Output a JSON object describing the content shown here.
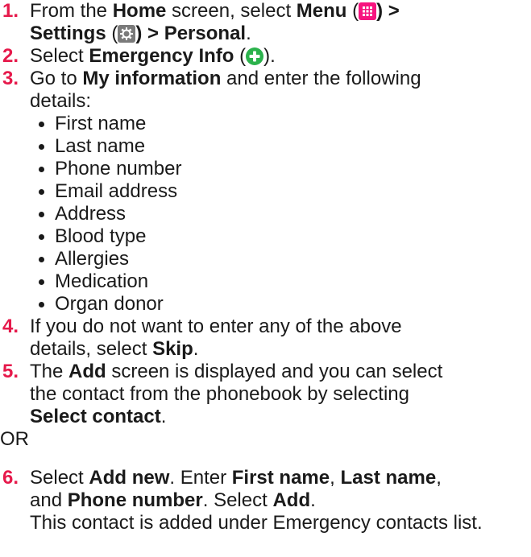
{
  "steps": [
    {
      "number": "1.",
      "line1_pre": "From the ",
      "line1_home": "Home",
      "line1_mid": " screen, select ",
      "line1_menu": "Menu",
      "line1_paren_open": " (",
      "line1_paren_close": ") >",
      "line2_settings": "Settings",
      "line2_paren_open": " (",
      "line2_paren_close": ") > ",
      "line2_personal": "Personal",
      "line2_end": "."
    },
    {
      "number": "2.",
      "pre": "Select ",
      "bold": "Emergency Info",
      "paren_open": " (",
      "paren_close": ")."
    },
    {
      "number": "3.",
      "pre": "Go to ",
      "bold": "My information",
      "post": " and enter the following",
      "line2": "details:",
      "bullets": [
        "First name",
        "Last name",
        "Phone number",
        "Email address",
        "Address",
        "Blood type",
        "Allergies",
        "Medication",
        "Organ donor"
      ]
    },
    {
      "number": "4.",
      "line1": "If you do not want to enter any of the above",
      "line2_pre": "details, select ",
      "line2_bold": "Skip",
      "line2_end": "."
    },
    {
      "number": "5.",
      "line1_pre": "The ",
      "line1_bold": "Add",
      "line1_post": " screen is displayed and you can select",
      "line2": "the contact from the phonebook by selecting",
      "line3_bold": "Select contact",
      "line3_end": "."
    },
    {
      "number": "6.",
      "line1_pre": "Select ",
      "line1_b1": "Add new",
      "line1_mid": ". Enter ",
      "line1_b2": "First name",
      "line1_comma": ", ",
      "line1_b3": "Last name",
      "line1_end": ",",
      "line2_pre": "and ",
      "line2_b1": "Phone number",
      "line2_mid": ". Select ",
      "line2_b2": "Add",
      "line2_end": ".",
      "line3": "This contact is added under Emergency contacts list."
    }
  ],
  "or_text": "OR",
  "icons": {
    "menu": "menu-grid-icon",
    "settings": "settings-gear-icon",
    "emergency": "emergency-plus-icon"
  },
  "colors": {
    "step_number": "#e6194b",
    "menu_icon": "#f7147f",
    "settings_icon": "#7a7a7a",
    "emergency_icon": "#2bb24c"
  }
}
